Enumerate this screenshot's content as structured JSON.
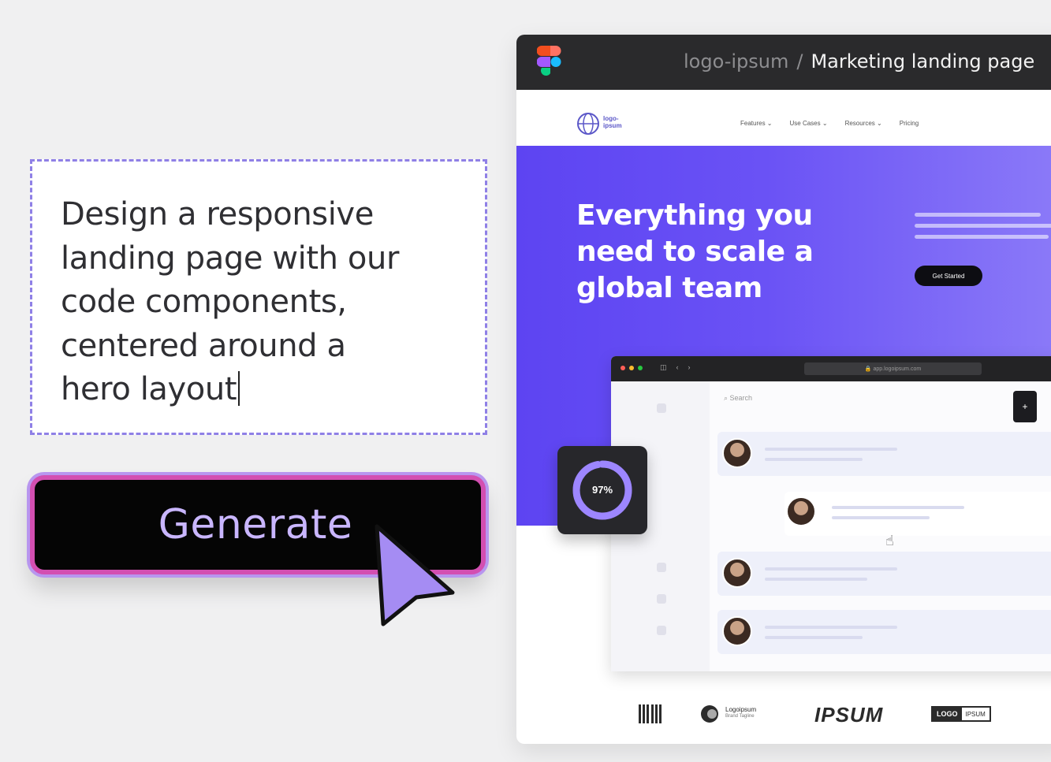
{
  "prompt": {
    "text": "Design a responsive\nlanding page with our\ncode components,\ncentered around a\nhero layout"
  },
  "generate_button": {
    "label": "Generate"
  },
  "figma": {
    "project": "logo-ipsum",
    "separator": "/",
    "file": "Marketing landing page"
  },
  "site": {
    "logo_text": "logo-\nipsum",
    "nav": [
      "Features ⌄",
      "Use Cases ⌄",
      "Resources ⌄",
      "Pricing"
    ],
    "hero_title": "Everything you need to scale a global team",
    "cta": "Get Started"
  },
  "app": {
    "url": "🔒 app.logoipsum.com",
    "search_placeholder": "Search",
    "add_label": "+",
    "progress": {
      "value_percent": 97,
      "label": "97%"
    }
  },
  "logos": {
    "logo2_name": "Logoipsum",
    "logo2_sub": "Brand Tagline",
    "logo3": "IPSUM",
    "logo4_left": "LOGO",
    "logo4_right": "IPSUM"
  },
  "colors": {
    "hero": "#5d44f2",
    "accent_lavender": "#c9b6ff",
    "button_border": "#d34fb1",
    "dashed_border": "#8f80e6"
  }
}
